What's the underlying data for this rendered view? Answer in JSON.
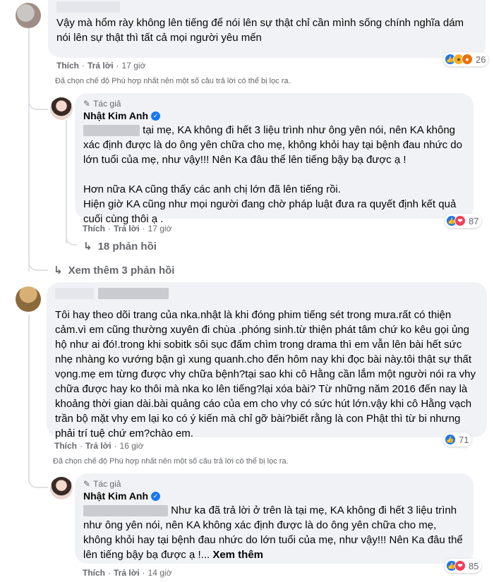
{
  "comment1": {
    "text": "Vậy mà hổm rày không lên tiếng để nói lên sự thật chỉ cần mình sống chính nghĩa dám nói lên sự thật thì tất cả mọi người yêu mến",
    "like": "Thích",
    "reply": "Trả lời",
    "time": "17 giờ",
    "reaction_count": "26",
    "filter_note": "Đã chọn chế độ Phù hợp nhất nên một số câu trả lời có thể bị lọc ra."
  },
  "reply1": {
    "author_tag": "Tác giả",
    "author_name": "Nhật Kim Anh",
    "text": "tại mẹ, KA không đi hết 3 liệu trình như ông yên nói, nên KA không xác định được là do ông yên chữa cho mẹ, không khỏi hay tại bệnh đau nhức do lớn tuổi của mẹ, như vậy!!! Nên Ka đâu thể lên tiếng bậy bạ được ạ !\n\nHơn nữa KA cũng thấy các anh chị lớn đã lên tiếng rồi.\nHiện giờ KA cũng như mọi người đang chờ pháp luật đưa ra quyết định kết quả cuối cùng thôi ạ .",
    "like": "Thích",
    "reply": "Trả lời",
    "time": "17 giờ",
    "reaction_count": "87",
    "replies_label": "18 phản hồi"
  },
  "see_more_replies": "Xem thêm 3 phản hồi",
  "comment2": {
    "text": "Tôi hay theo dõi trang của nka.nhật là khi đóng phim tiếng sét trong mưa.rất có thiện cảm.vì em cũng thường xuyên đi chùa .phóng sinh.từ thiện phát tâm chứ ko kêu gọi ủng hộ như ai đó!.trong khi sobitk sôi sục đấm chìm trong drama thì em vẫn lên bài hết sức nhẹ nhàng ko vướng bận gì xung quanh.cho đến hôm nay khi đọc bài này.tôi thật sự thất vọng.mẹ em từng được vhy chữa bệnh?tại sao khi cô Hằng cần lắm một người nói ra vhy chữa được hay ko thôi mà nka ko lên tiếng?lại xóa bài? Từ những năm 2016 đến nay là khoảng thời gian dài.bài quảng cáo của em cho vhy có sức hút lớn.vậy khi cô Hằng vạch trần bộ mặt vhy em lại ko có ý kiến mà chỉ gỡ bài?biết rằng là con Phật thì từ bi nhưng phải trí tuệ chứ em?chào em.",
    "like": "Thích",
    "reply": "Trả lời",
    "time": "16 giờ",
    "reaction_count": "71",
    "filter_note": "Đã chọn chế độ Phù hợp nhất nên một số câu trả lời có thể bị lọc ra."
  },
  "reply2": {
    "author_tag": "Tác giả",
    "author_name": "Nhật Kim Anh",
    "text": "Như ka đã trả lời ở trên là tại mẹ, KA không đi hết 3 liệu trình như ông yên nói, nên KA không xác định được là do ông yên chữa cho mẹ, không khỏi hay tại bệnh đau nhức do lớn tuổi của mẹ, như vậy!!! Nên Ka đâu thể lên tiếng bậy bạ được ạ !... ",
    "see_more": "Xem thêm",
    "like": "Thích",
    "reply": "Trả lời",
    "time": "14 giờ",
    "reaction_count": "85"
  }
}
